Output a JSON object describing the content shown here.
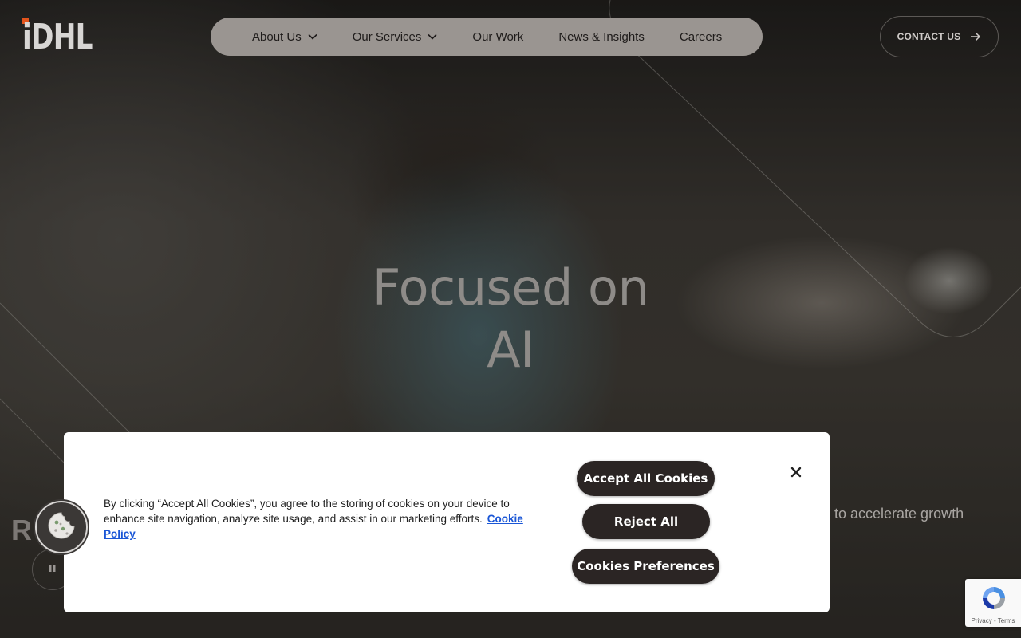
{
  "brand": {
    "logo_text": "iDHL",
    "accent_color": "#e3541c"
  },
  "nav": {
    "items": [
      {
        "label": "About Us",
        "has_dropdown": true
      },
      {
        "label": "Our Services",
        "has_dropdown": true
      },
      {
        "label": "Our Work",
        "has_dropdown": false
      },
      {
        "label": "News & Insights",
        "has_dropdown": false
      },
      {
        "label": "Careers",
        "has_dropdown": false
      }
    ],
    "contact_label": "CONTACT US",
    "contact_icon": "arrow-right-icon"
  },
  "hero": {
    "headline_line1": "Focused on",
    "headline_line2": "AI",
    "subtext_right": "to accelerate growth",
    "subtext_left": "R",
    "pause_icon": "pause-icon"
  },
  "cookie_banner": {
    "text": "By clicking “Accept All Cookies”, you agree to the storing of cookies on your device to enhance site navigation, analyze site usage, and assist in our marketing efforts.",
    "policy_link": "Cookie Policy",
    "accept_label": "Accept All Cookies",
    "reject_label": "Reject All",
    "preferences_label": "Cookies Preferences",
    "close_icon": "close-icon",
    "floating_icon": "cookie-icon"
  },
  "recaptcha": {
    "terms_text": "Privacy - Terms"
  }
}
